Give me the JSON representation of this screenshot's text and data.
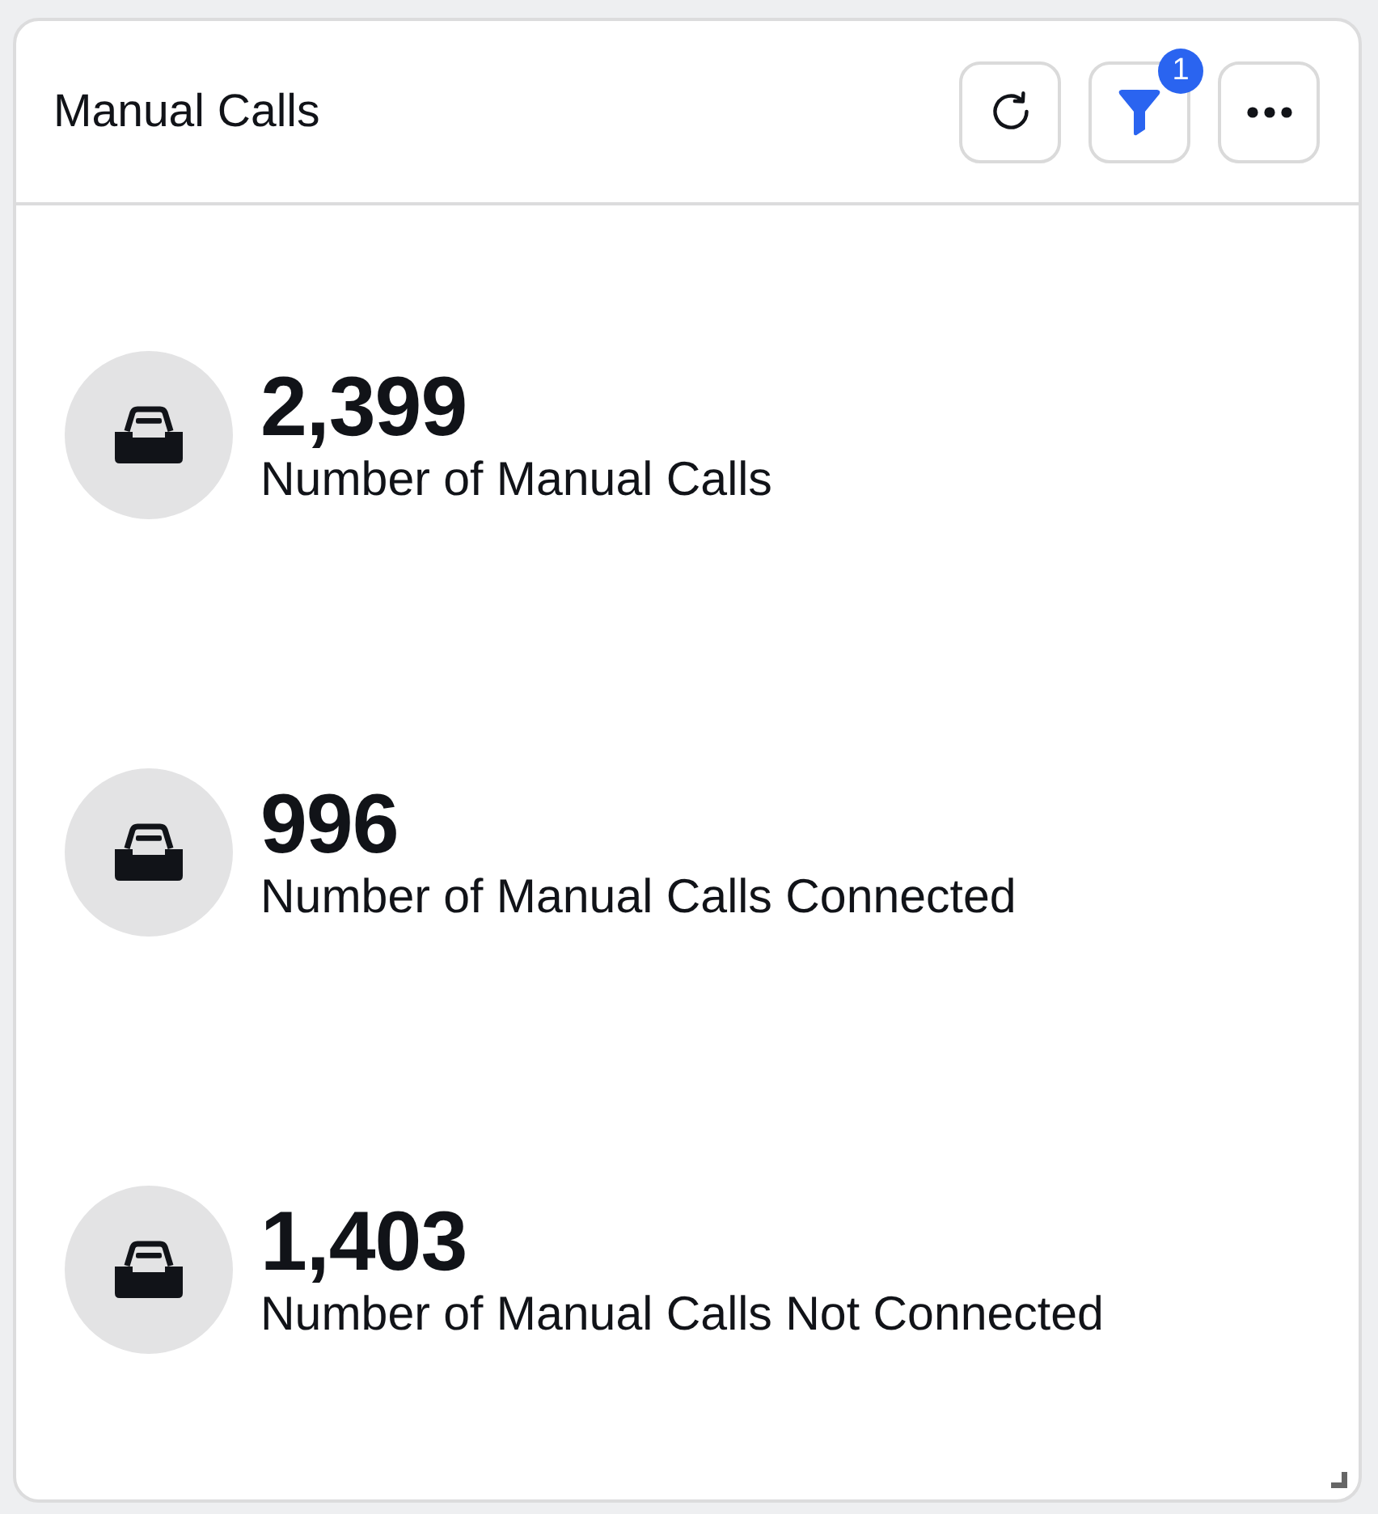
{
  "widget": {
    "title": "Manual Calls",
    "actions": [
      {
        "kind": "refresh"
      },
      {
        "kind": "filter",
        "badge": "1"
      },
      {
        "kind": "more"
      }
    ]
  },
  "metrics": [
    {
      "value": "2,399",
      "label": "Number of Manual Calls"
    },
    {
      "value": "996",
      "label": "Number of Manual Calls Connected"
    },
    {
      "value": "1,403",
      "label": "Number of Manual Calls Not Connected"
    }
  ]
}
